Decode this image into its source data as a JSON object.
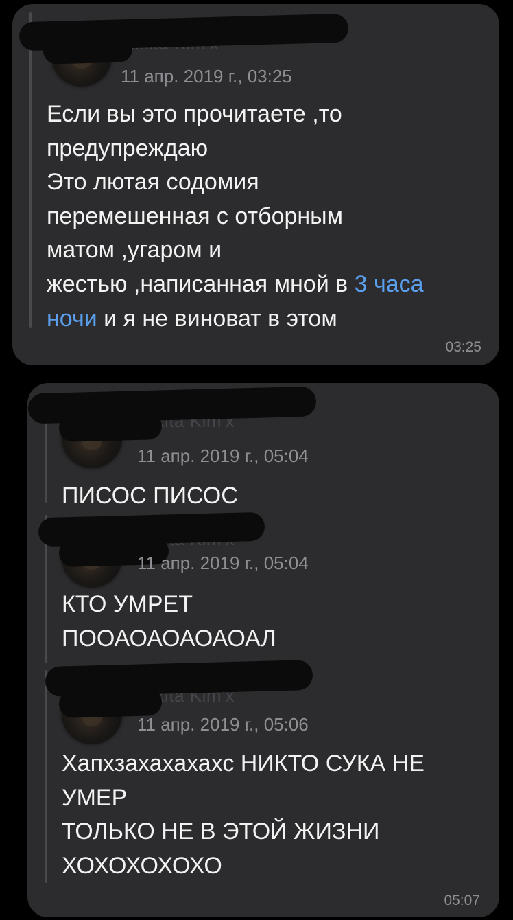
{
  "colors": {
    "background": "#000000",
    "bubble": "#2c2c2e",
    "text": "#f2f2f2",
    "muted": "#8e8e93",
    "link": "#5aa0ef",
    "sender": "#46464a"
  },
  "messages": [
    {
      "time": "03:25",
      "forwards": [
        {
          "sender": "Nikita Kim'x",
          "date": "11 апр. 2019 г., 03:25",
          "text_before": "Если вы это прочитаете ,то\nпредупреждаю\nЭто лютая содомия\nперемешенная  с отборным\nматом  ,угаром и\nжестью ,написанная мной в ",
          "link_line1": "3 часа",
          "link_line2": "ночи",
          "text_after": " и я не виноват в этом"
        }
      ]
    },
    {
      "time": "05:07",
      "forwards": [
        {
          "sender": "Nikita Kim'x",
          "date": "11 апр. 2019 г., 05:04",
          "text": "ПИСОС ПИСОС"
        },
        {
          "sender": "Nikita Kim'x",
          "date": "11 апр. 2019 г., 05:04",
          "text": "КТО УМРЕТ\nПООАОАОАОАОАЛ"
        },
        {
          "sender": "Nikita Kim'x",
          "date": "11 апр. 2019 г., 05:06",
          "text": "Хапхзахахахахс НИКТО СУКА НЕ\nУМЕР\nТОЛЬКО НЕ В ЭТОЙ ЖИЗНИ\nХОХОХОХОХО"
        }
      ]
    }
  ]
}
